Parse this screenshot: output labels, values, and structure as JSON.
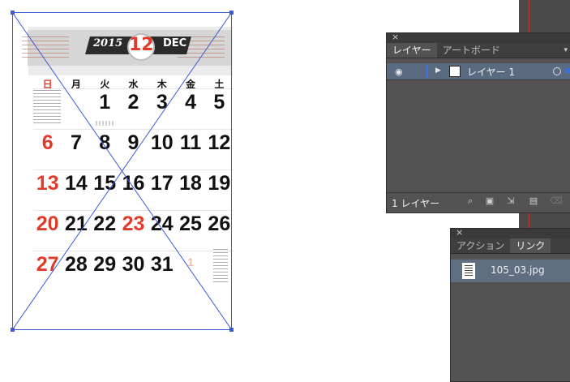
{
  "calendar": {
    "year": "2015",
    "month_num": "12",
    "month_abbr": "DEC",
    "weekdays": [
      "日",
      "月",
      "火",
      "水",
      "木",
      "金",
      "土"
    ],
    "weeks": [
      [
        "",
        "",
        "1",
        "2",
        "3",
        "4",
        "5"
      ],
      [
        "6",
        "7",
        "8",
        "9",
        "10",
        "11",
        "12"
      ],
      [
        "13",
        "14",
        "15",
        "16",
        "17",
        "18",
        "19"
      ],
      [
        "20",
        "21",
        "22",
        "23",
        "24",
        "25",
        "26"
      ],
      [
        "27",
        "28",
        "29",
        "30",
        "31",
        "1",
        ""
      ]
    ]
  },
  "layers_panel": {
    "tabs": [
      "レイヤー",
      "アートボード"
    ],
    "active_tab": "レイヤー",
    "layer_name": "レイヤー 1",
    "footer_label": "1 レイヤー",
    "layer_color": "#3b6fe0"
  },
  "links_panel": {
    "tabs": [
      "アクション",
      "リンク"
    ],
    "active_tab": "リンク",
    "file_name": "105_03.jpg"
  },
  "colors": {
    "sunday_red": "#e23a2a",
    "selection_blue": "#3b5bd9"
  }
}
